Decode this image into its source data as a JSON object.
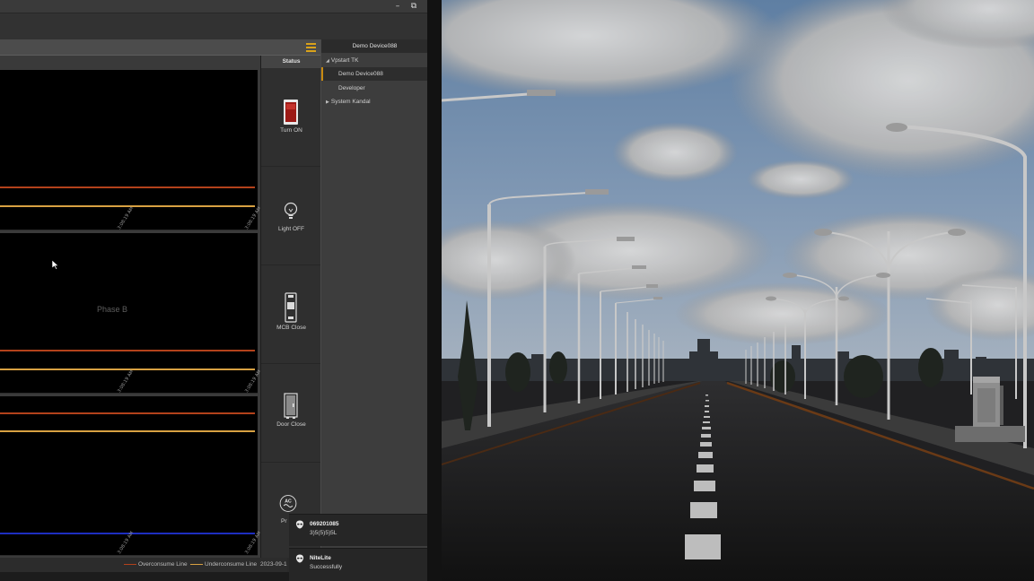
{
  "window": {
    "minimize_glyph": "–",
    "restore_glyph": "⧉"
  },
  "toolbar": {
    "menu_icon": "hamburger-icon",
    "accent": "#d9a21a"
  },
  "chart": {
    "panels": [
      {
        "label": "",
        "ticks": [
          "3:08:19 AM",
          "3:08:19 AM"
        ]
      },
      {
        "label": "Phase B",
        "ticks": [
          "3:08:19 AM",
          "3:08:19 AM"
        ]
      },
      {
        "label": "",
        "ticks": [
          "3:08:19 AM",
          "3:08:19 AM"
        ]
      }
    ],
    "legend": {
      "overconsume": "Overconsume Line",
      "underconsume": "Underconsume Line",
      "timestamp": "2023-09-1"
    },
    "colors": {
      "overconsume": "#b3421b",
      "underconsume": "#d8a142",
      "baseline": "#1d2ec0"
    }
  },
  "status": {
    "title": "Status",
    "items": [
      {
        "label": "Turn ON",
        "icon": "switch-icon"
      },
      {
        "label": "Light OFF",
        "icon": "light-bulb-icon"
      },
      {
        "label": "MCB Close",
        "icon": "mcb-breaker-icon"
      },
      {
        "label": "Door Close",
        "icon": "cabinet-door-icon"
      },
      {
        "label": "Pr",
        "icon": "ac-power-icon",
        "icon_text": "AC"
      }
    ]
  },
  "tree": {
    "header": "Demo Device088",
    "items": [
      {
        "label": "Vpstart TK",
        "expanded": true
      },
      {
        "label": "Demo Device088",
        "selected": true
      },
      {
        "label": "Developer"
      },
      {
        "label": "System Kandal",
        "expanded": false
      }
    ]
  },
  "notifications": [
    {
      "title": "069201085",
      "body": "3)5(5)5)5L",
      "icon": "alien-head-icon"
    },
    {
      "title": "NiteLite",
      "body": "Successfully",
      "icon": "alien-head-icon"
    }
  ]
}
